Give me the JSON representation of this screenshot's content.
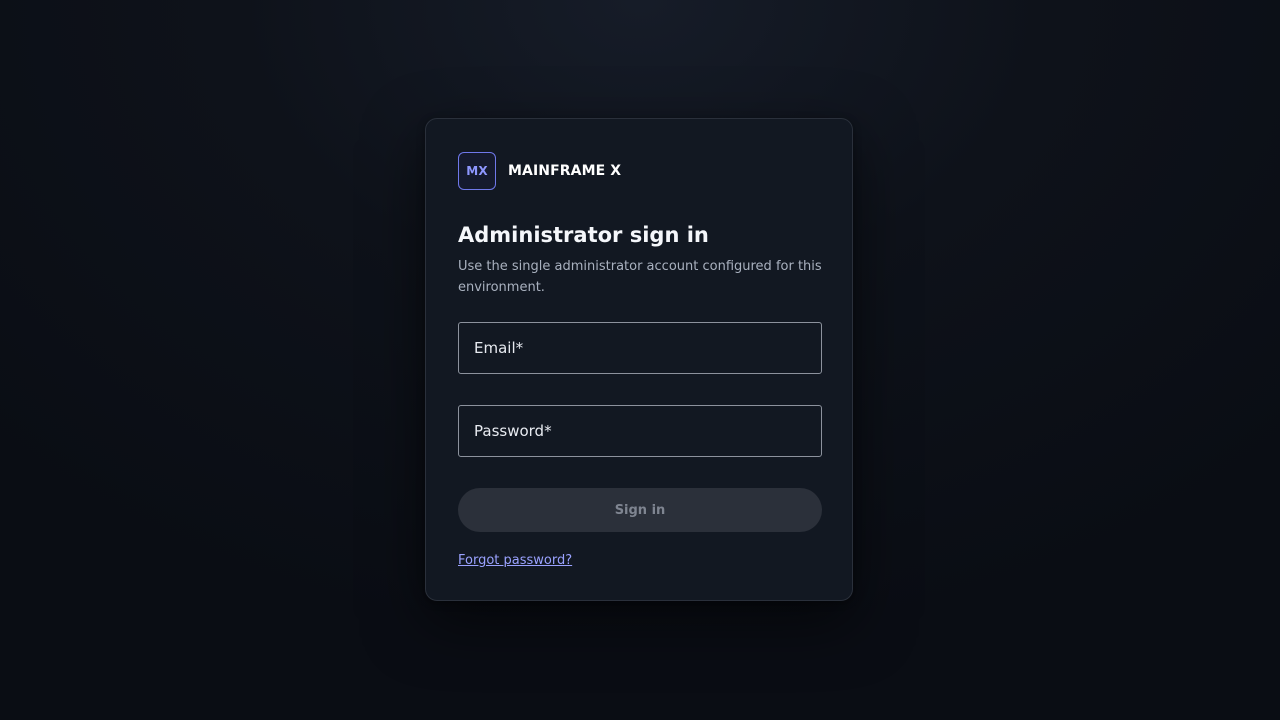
{
  "brand": {
    "logo_text": "MX",
    "name": "MAINFRAME X"
  },
  "signin": {
    "title": "Administrator sign in",
    "subtitle": "Use the single administrator account configured for this environment.",
    "email_placeholder": "Email*",
    "password_placeholder": "Password*",
    "email_value": "",
    "password_value": "",
    "button_label": "Sign in",
    "forgot_label": "Forgot password?",
    "button_state": "disabled"
  },
  "colors": {
    "accent": "#8e97ff",
    "background": "#0e121a",
    "card": "#121822",
    "button_disabled": "#2b303a"
  },
  "icons": {
    "logo": "mx-logo-mark"
  }
}
